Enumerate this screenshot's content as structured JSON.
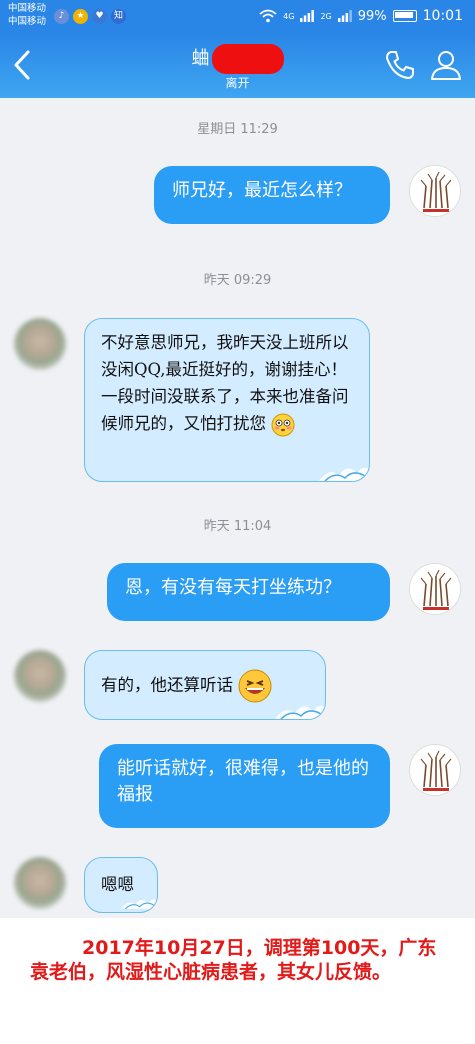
{
  "status_bar": {
    "carrier_1": "中国移动",
    "carrier_2": "中国移动",
    "network_1": "4G",
    "network_2": "2G",
    "battery": "99%",
    "time": "10:01"
  },
  "header": {
    "contact_name_visible": "蛐",
    "contact_status": "离开",
    "colors": {
      "bar": "#2a86e6",
      "redaction": "#ee1010"
    }
  },
  "messages": [
    {
      "type": "timestamp",
      "text": "星期日 11:29"
    },
    {
      "type": "out",
      "text": "师兄好，最近怎么样？"
    },
    {
      "type": "timestamp",
      "text": "昨天 09:29"
    },
    {
      "type": "in",
      "text": "不好意思师兄，我昨天没上班所以没闲QQ,最近挺好的，谢谢挂心！一段时间没联系了，本来也准备问候师兄的，又怕打扰您",
      "emoji": "flushed-emoji"
    },
    {
      "type": "timestamp",
      "text": "昨天 11:04"
    },
    {
      "type": "out",
      "text": "恩，有没有每天打坐练功？"
    },
    {
      "type": "in",
      "text": "有的，他还算听话",
      "emoji": "grinning-emoji"
    },
    {
      "type": "out",
      "text": "能听话就好，很难得，也是他的福报"
    },
    {
      "type": "in",
      "text": "嗯嗯"
    }
  ],
  "footer": {
    "caption": "2017年10月27日，调理第100天，广东袁老伯，风湿性心脏病患者，其女儿反馈。",
    "color": "#e11a1a"
  }
}
